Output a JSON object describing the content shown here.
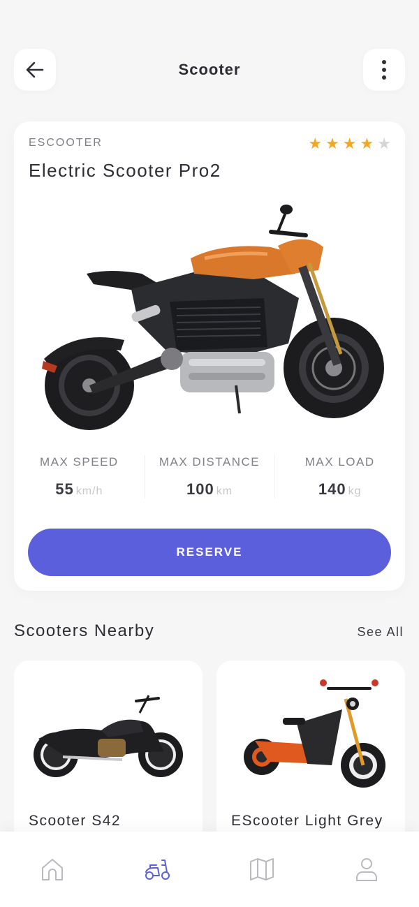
{
  "header": {
    "title": "Scooter",
    "back_icon": "arrow-left-icon",
    "menu_icon": "more-vertical-icon"
  },
  "featured": {
    "category": "ESCOOTER",
    "name": "Electric Scooter Pro2",
    "rating": 4,
    "rating_max": 5,
    "image_icon": "electric-motorcycle-orange-image",
    "specs": [
      {
        "label": "MAX SPEED",
        "value": "55",
        "unit": "km/h"
      },
      {
        "label": "MAX DISTANCE",
        "value": "100",
        "unit": "km"
      },
      {
        "label": "MAX LOAD",
        "value": "140",
        "unit": "kg"
      }
    ],
    "reserve_label": "RESERVE"
  },
  "nearby": {
    "title": "Scooters Nearby",
    "see_all_label": "See All",
    "items": [
      {
        "name": "Scooter S42",
        "image_icon": "black-cruiser-motorcycle-image"
      },
      {
        "name": "EScooter Light Grey",
        "image_icon": "electric-moped-orange-image"
      }
    ]
  },
  "bottom_nav": [
    {
      "name": "Home",
      "icon": "home-icon",
      "active": false
    },
    {
      "name": "Scooter",
      "icon": "scooter-icon",
      "active": true
    },
    {
      "name": "Map",
      "icon": "map-icon",
      "active": false
    },
    {
      "name": "Profile",
      "icon": "user-icon",
      "active": false
    }
  ],
  "colors": {
    "accent": "#5b5fdc",
    "star": "#f5a623",
    "star_off": "#d5d5d8",
    "background": "#f6f6f7",
    "inactive_icon": "#b9b9be"
  }
}
